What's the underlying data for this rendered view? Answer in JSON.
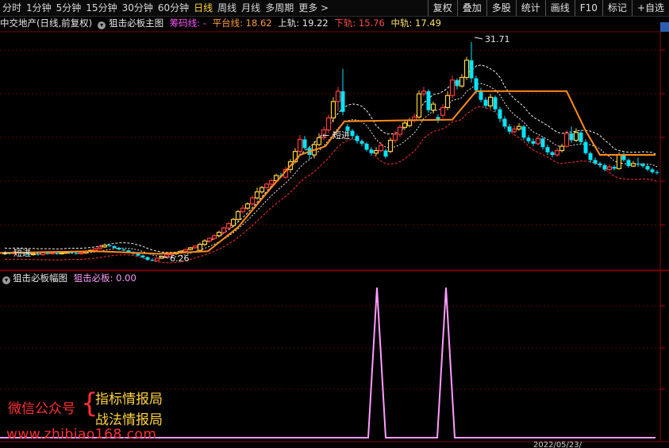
{
  "periods": [
    "分时",
    "1分钟",
    "5分钟",
    "15分钟",
    "30分钟",
    "60分钟",
    "日线",
    "周线",
    "月线",
    "多周期",
    "更多 >"
  ],
  "active_period": "日线",
  "tools": [
    "复权",
    "叠加",
    "多股",
    "统计",
    "画线",
    "F10",
    "标记",
    "+自选"
  ],
  "main_info": {
    "stock": "中交地产(日线,前复权)",
    "indicator": "狙击必板主图",
    "chip_label": "筹码线: -",
    "platform": "平台线: 18.62",
    "upper": "上轨: 19.22",
    "lower": "下轨: 15.76",
    "middle": "中轨: 17.49"
  },
  "sub_info": {
    "indicator": "狙击必板幅图",
    "value": "狙击必板: 0.00"
  },
  "annotations": {
    "high_price": "31.71",
    "low_price": "6.26",
    "signal_left": "短进",
    "signal_mid": "短进"
  },
  "watermark": {
    "wechat": "微信公众号",
    "brand1": "指标情报局",
    "brand2": "战法情报局",
    "site": "www.zhibiao168.com"
  },
  "bottom": {
    "date": "2022/05/23/"
  },
  "colors": {
    "up": "#ff3c3c",
    "down": "#00e5ff",
    "yellow": "#ffd23c",
    "orange": "#ff8c1a",
    "pink": "#ff9cff"
  }
}
